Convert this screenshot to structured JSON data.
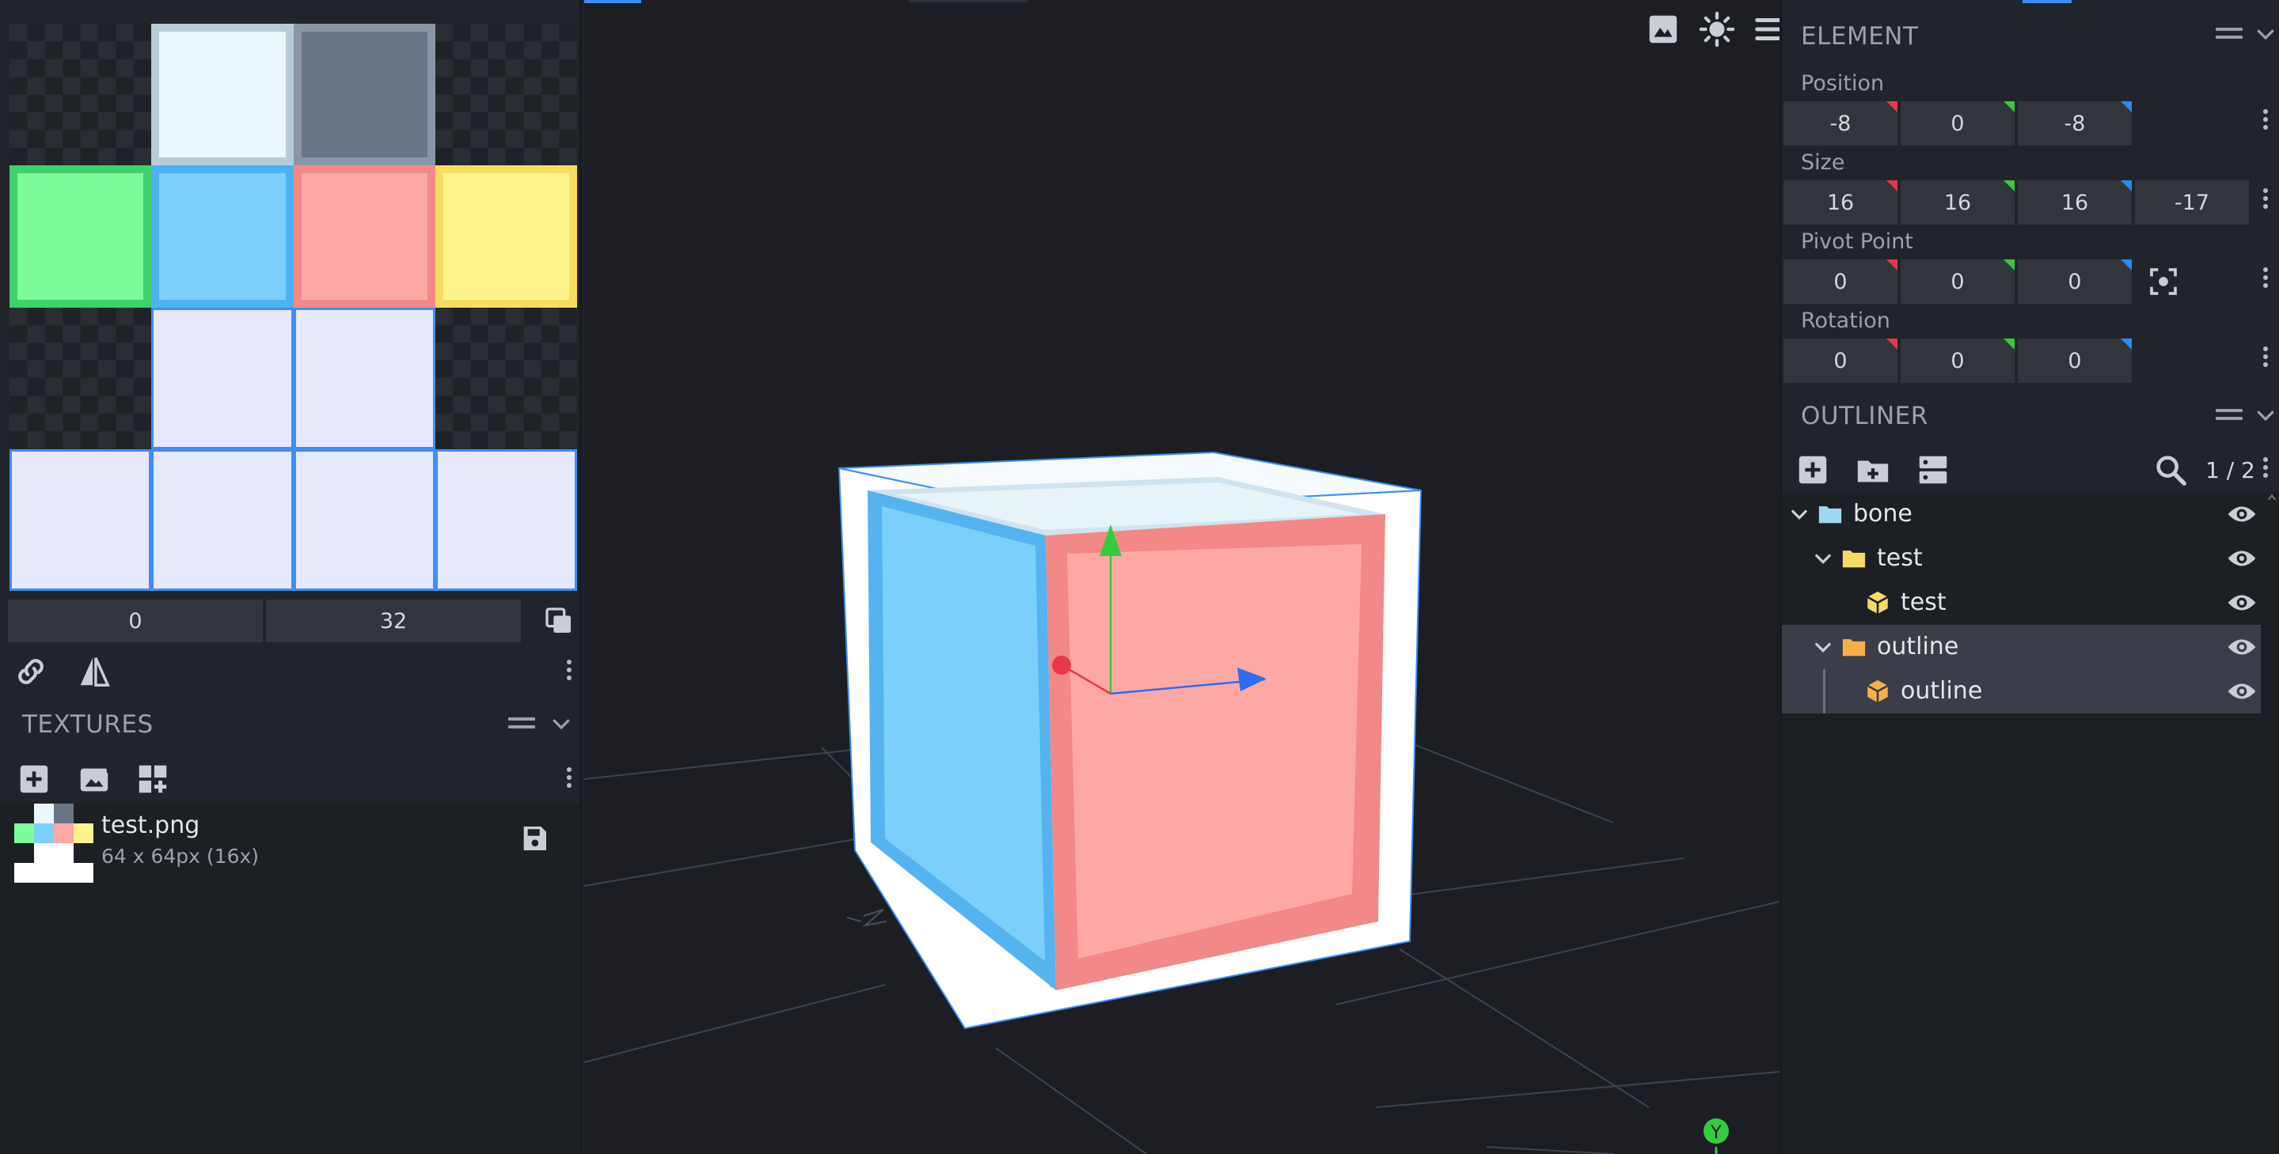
{
  "uv_editor": {
    "offset_x": "0",
    "offset_y": "32"
  },
  "textures": {
    "title": "TEXTURES",
    "items": [
      {
        "name": "test.png",
        "size": "64 x 64px (16x)"
      }
    ]
  },
  "element": {
    "title": "ELEMENT",
    "position": {
      "label": "Position",
      "x": "-8",
      "y": "0",
      "z": "-8"
    },
    "size": {
      "label": "Size",
      "x": "16",
      "y": "16",
      "z": "16",
      "inflate": "-17"
    },
    "pivot": {
      "label": "Pivot Point",
      "x": "0",
      "y": "0",
      "z": "0"
    },
    "rotation": {
      "label": "Rotation",
      "x": "0",
      "y": "0",
      "z": "0"
    }
  },
  "outliner": {
    "title": "OUTLINER",
    "count": "1 / 2",
    "items": [
      {
        "label": "bone",
        "type": "folder",
        "color": "#9fd8f5"
      },
      {
        "label": "test",
        "type": "folder",
        "color": "#f5d96a"
      },
      {
        "label": "test",
        "type": "cube",
        "color": "#f5d96a"
      },
      {
        "label": "outline",
        "type": "folder",
        "color": "#f5b04a"
      },
      {
        "label": "outline",
        "type": "cube",
        "color": "#f5b04a"
      }
    ]
  },
  "viewport": {
    "axis_label": "Y",
    "icons": [
      "image-icon",
      "sun-icon",
      "menu-icon"
    ]
  },
  "colors": {
    "accent": "#3e8ef7",
    "axis_x": "#e8374b",
    "axis_y": "#34cb3e",
    "axis_z": "#2a8bf0"
  }
}
